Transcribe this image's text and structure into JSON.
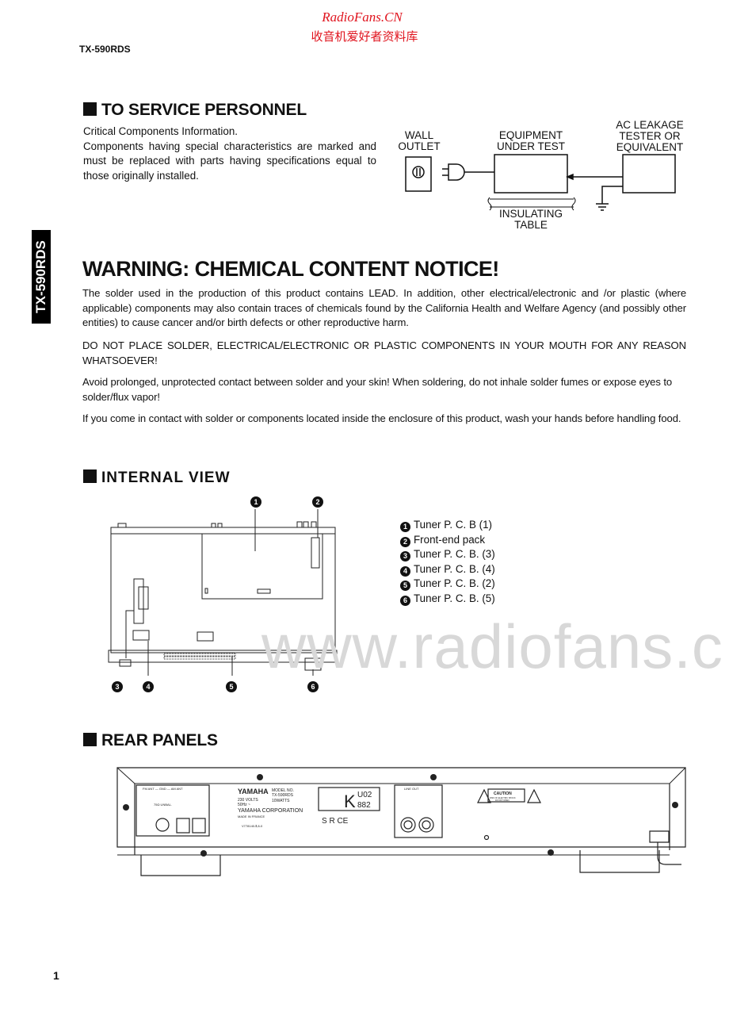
{
  "header": {
    "site_title": "RadioFans.CN",
    "site_subtitle": "收音机爱好者资料库",
    "model": "TX-590RDS",
    "side_tab": "TX-590RDS"
  },
  "service": {
    "heading": "TO SERVICE PERSONNEL",
    "lines": [
      "Critical Components Information.",
      "Components having special characteristics are marked and must be replaced with parts having specifications equal to those originally installed."
    ],
    "diagram": {
      "wall_outlet": [
        "WALL",
        "OUTLET"
      ],
      "equipment": [
        "EQUIPMENT",
        "UNDER TEST"
      ],
      "tester": [
        "AC LEAKAGE",
        "TESTER OR",
        "EQUIVALENT"
      ],
      "table": [
        "INSULATING",
        "TABLE"
      ]
    }
  },
  "warning": {
    "title": "WARNING: CHEMICAL CONTENT NOTICE!",
    "paragraphs": [
      "The solder used in the production of this product contains LEAD.  In addition, other electrical/electronic and /or plastic (where applicable) components may also contain traces of chemicals found by the California Health and Welfare Agency (and possibly other entities) to cause cancer and/or birth defects or other reproductive harm.",
      "DO NOT PLACE SOLDER, ELECTRICAL/ELECTRONIC OR PLASTIC COMPONENTS IN YOUR MOUTH FOR ANY REASON WHATSOEVER!",
      "Avoid prolonged, unprotected contact between solder and your skin!  When soldering, do not inhale solder fumes or expose eyes to solder/flux vapor!",
      "If you come in contact with solder or components located inside the enclosure of this product, wash your hands before handling food."
    ]
  },
  "internal_view": {
    "heading": "INTERNAL VIEW",
    "callouts": [
      "1",
      "2",
      "3",
      "4",
      "5",
      "6"
    ],
    "legend": [
      {
        "num": "1",
        "label": "Tuner P. C. B (1)"
      },
      {
        "num": "2",
        "label": "Front-end pack"
      },
      {
        "num": "3",
        "label": "Tuner P. C. B. (3)"
      },
      {
        "num": "4",
        "label": "Tuner P. C. B. (4)"
      },
      {
        "num": "5",
        "label": "Tuner P. C. B. (2)"
      },
      {
        "num": "6",
        "label": "Tuner P. C. B. (5)"
      }
    ]
  },
  "rear_panels": {
    "heading": "REAR PANELS",
    "antenna_label": "FM ANT — GND — AM ANT",
    "unbal_label": "75Ω UNBAL.",
    "brand": "YAMAHA",
    "model_no_label": "MODEL NO.",
    "model_no": "TX-590RDS",
    "voltage": "230 VOLTS",
    "freq": "50Hz ~",
    "watts": "10WATTS",
    "corp": "YAMAHA CORPORATION",
    "made_in": "MADE IN FRANCE",
    "code": "V778140-Ⅱ,8-0",
    "approval_top": "U02",
    "approval_bottom": "882",
    "approval_k": "K",
    "line_out": "LINE OUT",
    "caution": "CAUTION",
    "caution_sub": [
      "RISK OF ELECTRIC SHOCK",
      "DO NOT OPEN"
    ],
    "marks": "S R CE"
  },
  "watermark": "www.radiofans.c",
  "footer": {
    "page": "1"
  }
}
